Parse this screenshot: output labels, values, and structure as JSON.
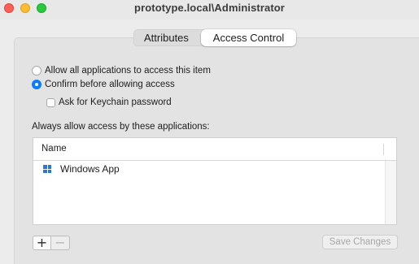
{
  "window": {
    "title": "prototype.local\\Administrator"
  },
  "tabs": [
    {
      "label": "Attributes",
      "selected": false
    },
    {
      "label": "Access Control",
      "selected": true
    }
  ],
  "access": {
    "option_allow_all": "Allow all applications to access this item",
    "option_allow_all_selected": false,
    "option_confirm": "Confirm before allowing access",
    "option_confirm_selected": true,
    "keychain_checkbox_label": "Ask for Keychain password",
    "keychain_checkbox_checked": false
  },
  "apps_section": {
    "label": "Always allow access by these applications:",
    "column_header": "Name",
    "rows": [
      {
        "name": "Windows App",
        "icon": "windows-app-icon"
      }
    ]
  },
  "buttons": {
    "add": "+",
    "remove": "−",
    "save": "Save Changes",
    "save_enabled": false
  },
  "colors": {
    "accent": "#0a7cff",
    "close": "#fe5f57",
    "minimize": "#febc2e",
    "zoom": "#28c840"
  }
}
